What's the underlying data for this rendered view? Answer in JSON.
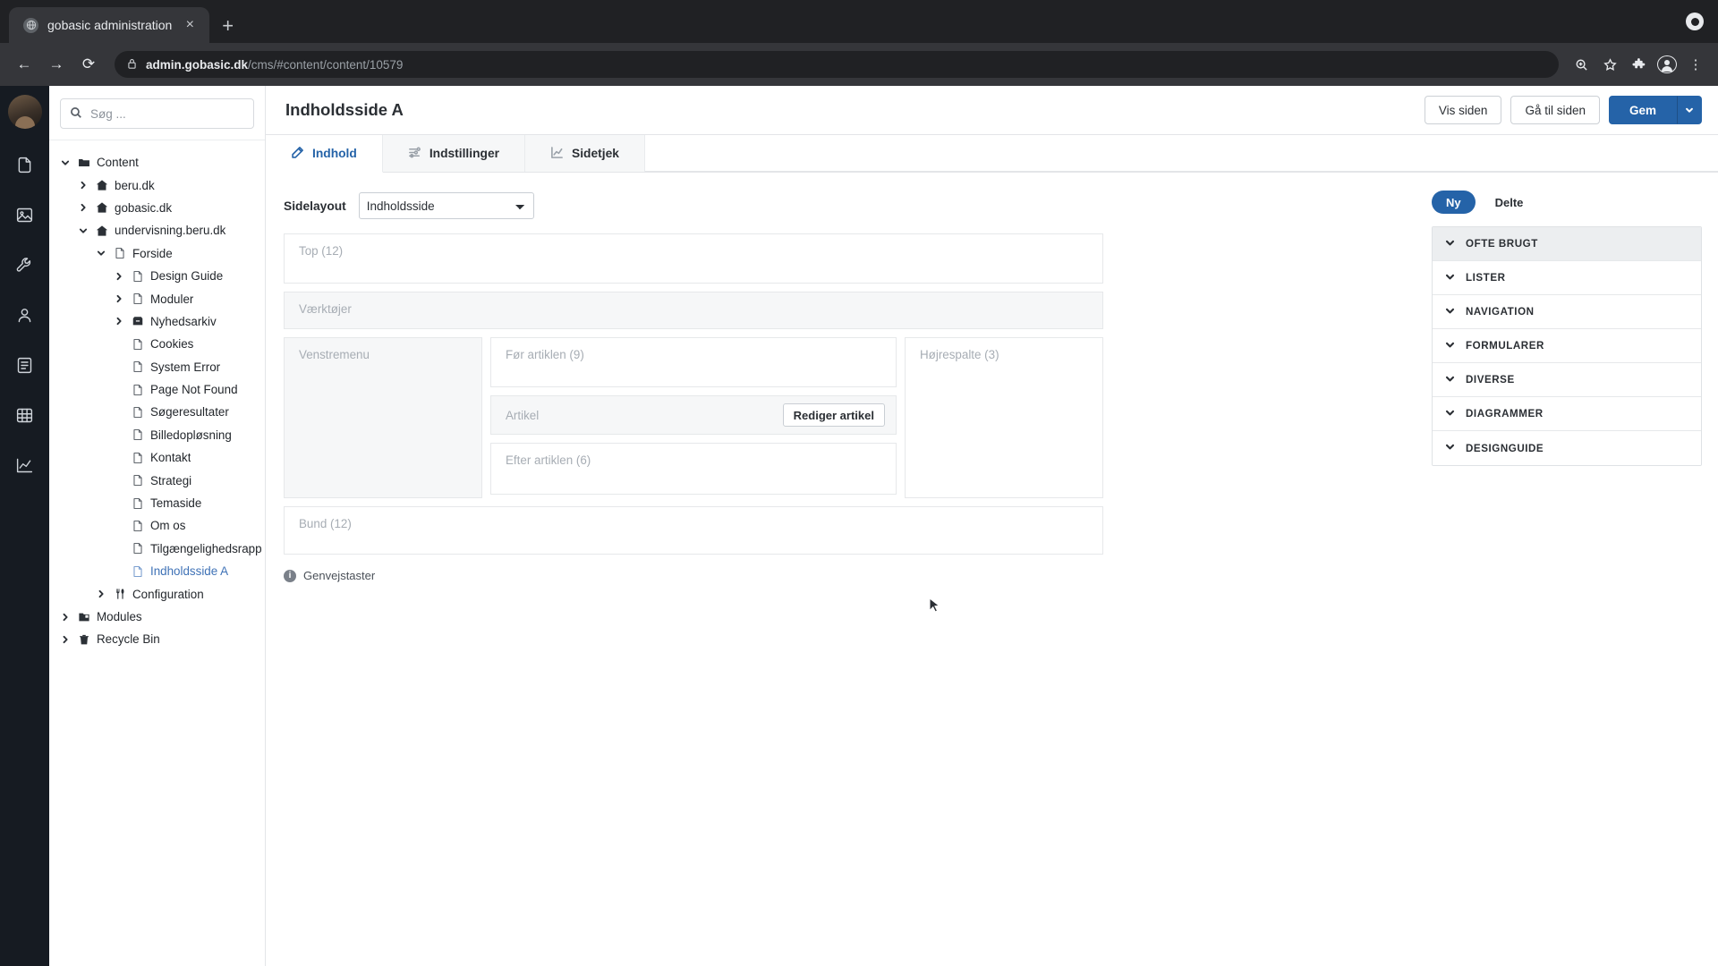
{
  "browser": {
    "tab": {
      "title": "gobasic administration",
      "favicon": "globe-icon",
      "close": "×"
    },
    "new_tab": "+",
    "back": "←",
    "forward": "→",
    "reload": "⟳",
    "url_host": "admin.gobasic.dk",
    "url_path": "/cms/#content/content/10579",
    "lock": "ὑ2",
    "omni": {
      "zoom": "zoom-icon",
      "bookmark": "☆",
      "extensions": "puzzle-icon",
      "profile": "profile-icon",
      "menu": "⋮"
    }
  },
  "rail": {
    "avatar": "user-avatar",
    "items": [
      {
        "name": "content-icon"
      },
      {
        "name": "media-icon"
      },
      {
        "name": "settings-wrench-icon"
      },
      {
        "name": "users-icon"
      },
      {
        "name": "forms-icon"
      },
      {
        "name": "tables-icon"
      },
      {
        "name": "analytics-icon"
      }
    ]
  },
  "search": {
    "placeholder": "Søg ...",
    "value": "",
    "icon": "search-icon"
  },
  "tree": [
    {
      "label": "Content",
      "depth": 0,
      "icon": "folder",
      "caret": "down",
      "selected": false
    },
    {
      "label": "beru.dk",
      "depth": 1,
      "icon": "home",
      "caret": "right",
      "selected": false
    },
    {
      "label": "gobasic.dk",
      "depth": 1,
      "icon": "home",
      "caret": "right",
      "selected": false
    },
    {
      "label": "undervisning.beru.dk",
      "depth": 1,
      "icon": "home",
      "caret": "down",
      "selected": false
    },
    {
      "label": "Forside",
      "depth": 2,
      "icon": "doc",
      "caret": "down",
      "selected": false
    },
    {
      "label": "Design Guide",
      "depth": 3,
      "icon": "doc",
      "caret": "right",
      "selected": false
    },
    {
      "label": "Moduler",
      "depth": 3,
      "icon": "doc",
      "caret": "right",
      "selected": false
    },
    {
      "label": "Nyhedsarkiv",
      "depth": 3,
      "icon": "archive",
      "caret": "right",
      "selected": false
    },
    {
      "label": "Cookies",
      "depth": 3,
      "icon": "doc",
      "caret": "none",
      "selected": false
    },
    {
      "label": "System Error",
      "depth": 3,
      "icon": "doc",
      "caret": "none",
      "selected": false
    },
    {
      "label": "Page Not Found",
      "depth": 3,
      "icon": "doc",
      "caret": "none",
      "selected": false
    },
    {
      "label": "Søgeresultater",
      "depth": 3,
      "icon": "doc",
      "caret": "none",
      "selected": false
    },
    {
      "label": "Billedopløsning",
      "depth": 3,
      "icon": "doc",
      "caret": "none",
      "selected": false
    },
    {
      "label": "Kontakt",
      "depth": 3,
      "icon": "doc",
      "caret": "none",
      "selected": false
    },
    {
      "label": "Strategi",
      "depth": 3,
      "icon": "doc",
      "caret": "none",
      "selected": false
    },
    {
      "label": "Temaside",
      "depth": 3,
      "icon": "doc",
      "caret": "none",
      "selected": false
    },
    {
      "label": "Om os",
      "depth": 3,
      "icon": "doc",
      "caret": "none",
      "selected": false
    },
    {
      "label": "Tilgængelighedsrapport",
      "depth": 3,
      "icon": "doc",
      "caret": "none",
      "selected": false
    },
    {
      "label": "Indholdsside A",
      "depth": 3,
      "icon": "doc",
      "caret": "none",
      "selected": true
    },
    {
      "label": "Configuration",
      "depth": 2,
      "icon": "config",
      "caret": "right",
      "selected": false
    },
    {
      "label": "Modules",
      "depth": 0,
      "icon": "modules",
      "caret": "right",
      "selected": false
    },
    {
      "label": "Recycle Bin",
      "depth": 0,
      "icon": "trash",
      "caret": "right",
      "selected": false
    }
  ],
  "header": {
    "title": "Indholdsside A",
    "view_button": "Vis siden",
    "goto_button": "Gå til siden",
    "save_button": "Gem",
    "save_caret": "chevron-down-icon"
  },
  "tabs": [
    {
      "label": "Indhold",
      "icon": "edit-icon",
      "active": true
    },
    {
      "label": "Indstillinger",
      "icon": "sliders-icon",
      "active": false
    },
    {
      "label": "Sidetjek",
      "icon": "chart-icon",
      "active": false
    }
  ],
  "layout": {
    "label": "Sidelayout",
    "selected": "Indholdsside",
    "options": [
      "Indholdsside"
    ]
  },
  "zones": {
    "top": "Top (12)",
    "tools": "Værktøjer",
    "left_menu": "Venstremenu",
    "before_article": "Før artiklen (9)",
    "article": "Artikel",
    "edit_article_button": "Rediger artikel",
    "after_article": "Efter artiklen (6)",
    "right_column": "Højrespalte (3)",
    "bottom": "Bund (12)"
  },
  "shortcuts": {
    "label": "Genvejstaster",
    "icon": "info-icon"
  },
  "right_panel": {
    "pills": [
      {
        "label": "Ny",
        "active": true
      },
      {
        "label": "Delte",
        "active": false
      }
    ],
    "accordion": [
      {
        "label": "OFTE BRUGT",
        "highlight": true
      },
      {
        "label": "LISTER",
        "highlight": false
      },
      {
        "label": "NAVIGATION",
        "highlight": false
      },
      {
        "label": "FORMULARER",
        "highlight": false
      },
      {
        "label": "DIVERSE",
        "highlight": false
      },
      {
        "label": "DIAGRAMMER",
        "highlight": false
      },
      {
        "label": "DESIGNGUIDE",
        "highlight": false
      }
    ]
  },
  "colors": {
    "accent": "#2563a8",
    "selected_text": "#3f72b6",
    "rail_bg": "#161b22",
    "chrome_bg": "#35363a"
  }
}
